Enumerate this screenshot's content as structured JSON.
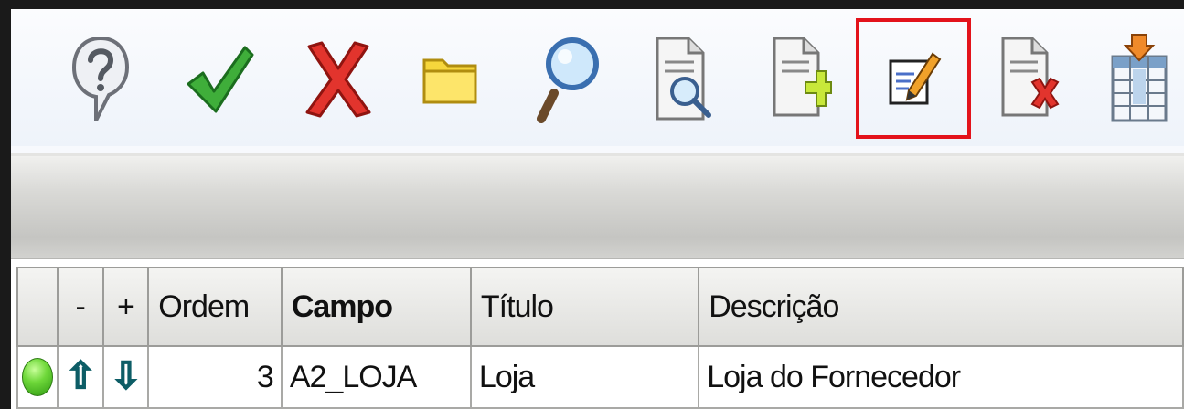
{
  "toolbar": {
    "buttons": [
      {
        "icon": "help-icon",
        "label": "Ajuda"
      },
      {
        "icon": "checkmark-icon",
        "label": "Confirmar"
      },
      {
        "icon": "cancel-x-icon",
        "label": "Cancelar"
      },
      {
        "icon": "folder-icon",
        "label": "Abrir"
      },
      {
        "icon": "magnifier-icon",
        "label": "Pesquisar"
      },
      {
        "icon": "document-search-icon",
        "label": "Visualizar"
      },
      {
        "icon": "document-add-icon",
        "label": "Incluir"
      },
      {
        "icon": "edit-pencil-icon",
        "label": "Alterar",
        "highlighted": true,
        "highlight_color": "#e3131b"
      },
      {
        "icon": "document-delete-icon",
        "label": "Excluir"
      },
      {
        "icon": "table-insert-icon",
        "label": "Inserir"
      }
    ]
  },
  "grid": {
    "columns": [
      "",
      "-",
      "+",
      "Ordem",
      "Campo",
      "Título",
      "Descrição"
    ],
    "rows": [
      {
        "status_icon": "green-status-icon",
        "up_icon": "arrow-up-icon",
        "down_icon": "arrow-down-icon",
        "ordem": "3",
        "campo": "A2_LOJA",
        "titulo": "Loja",
        "descricao": "Loja do Fornecedor"
      }
    ]
  },
  "colors": {
    "highlight": "#e3131b",
    "status_green": "#6fd83a",
    "arrow_cyan": "#19c4d6"
  }
}
